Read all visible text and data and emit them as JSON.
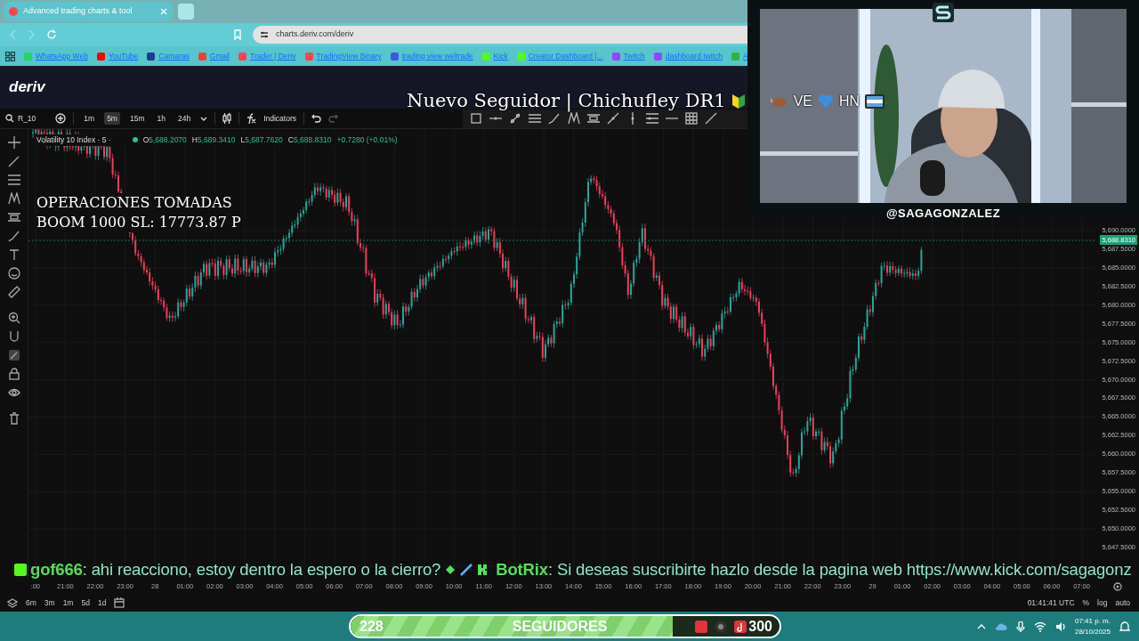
{
  "browser": {
    "tabs": [
      {
        "title": "Advanced trading charts & tool",
        "selected": true
      }
    ],
    "url": "charts.deriv.com/deriv",
    "bookmarks": [
      {
        "label": "WhatsApp Web",
        "color": "#25d366"
      },
      {
        "label": "YouTube",
        "color": "#ff0000"
      },
      {
        "label": "Camaras",
        "color": "#1d3f8a"
      },
      {
        "label": "Gmail",
        "color": "#ea4335"
      },
      {
        "label": "Trader | Deriv",
        "color": "#ff444f"
      },
      {
        "label": "TradingView Binary",
        "color": "#ff444f"
      },
      {
        "label": "trading view weltrade",
        "color": "#3b5bdb"
      },
      {
        "label": "Kick",
        "color": "#53fc18"
      },
      {
        "label": "Creator Dashboard |...",
        "color": "#53fc18"
      },
      {
        "label": "Twitch",
        "color": "#9146ff"
      },
      {
        "label": "dashboard twitch",
        "color": "#9146ff"
      },
      {
        "label": "A",
        "color": "#2fb344"
      }
    ]
  },
  "app": {
    "logo": "deriv",
    "symbol": "R_10",
    "intervals": [
      {
        "label": "1m",
        "selected": false
      },
      {
        "label": "5m",
        "selected": true
      },
      {
        "label": "15m",
        "selected": false
      },
      {
        "label": "1h",
        "selected": false
      },
      {
        "label": "24h",
        "selected": false
      }
    ],
    "indicators": "Indicators"
  },
  "legend": {
    "title": "Volatility 10 Index · 5 ·",
    "ohlc": [
      {
        "key": "O",
        "value": "5,688.2070"
      },
      {
        "key": "H",
        "value": "5,689.3410"
      },
      {
        "key": "L",
        "value": "5,687.7620"
      },
      {
        "key": "C",
        "value": "5,688.8310"
      }
    ],
    "change": "+0.7280 (+0.01%)"
  },
  "overlay_text": [
    "OPERACIONES TOMADAS",
    "BOOM 1000 SL: 17773.87 P"
  ],
  "price_axis": [
    "5,690.0000",
    "5,687.5000",
    "5,685.0000",
    "5,682.5000",
    "5,680.0000",
    "5,677.5000",
    "5,675.0000",
    "5,672.5000",
    "5,670.0000",
    "5,667.5000",
    "5,665.0000",
    "5,662.5000",
    "5,660.0000",
    "5,657.5000",
    "5,655.0000",
    "5,652.5000",
    "5,650.0000",
    "5,647.5000"
  ],
  "current_price": "5,688.8310",
  "time_axis": [
    ":00",
    "21:00",
    "22:00",
    "23:00",
    "28",
    "01:00",
    "02:00",
    "03:00",
    "04:00",
    "05:00",
    "06:00",
    "07:00",
    "08:00",
    "09:00",
    "10:00",
    "11:00",
    "12:00",
    "13:00",
    "14:00",
    "15:00",
    "16:00",
    "17:00",
    "18:00",
    "19:00",
    "20:00",
    "21:00",
    "22:00",
    "23:00",
    "29",
    "01:00",
    "02:00",
    "03:00",
    "04:00",
    "05:00",
    "06:00",
    "07:00"
  ],
  "periods": [
    "6m",
    "3m",
    "1m",
    "5d",
    "1d"
  ],
  "clock": "01:41:41 UTC",
  "scale_options": [
    "%",
    "log",
    "auto"
  ],
  "follower_alert": {
    "text": "Nuevo Seguidor | Chichufley DR1",
    "tags": [
      "VE",
      "HN"
    ]
  },
  "webcam": {
    "kind": "picture",
    "handle": "@SAGAGONZALEZ"
  },
  "chat": [
    {
      "user": "gof666",
      "message": ": ahi reacciono, estoy dentro la espero o la cierro?"
    },
    {
      "user": "BotRix",
      "message": ": Si deseas suscribirte hazlo desde la pagina web https://www.kick.com/sagagonz"
    }
  ],
  "follower_goal": {
    "current": "228",
    "label": "SEGUIDORES",
    "target": "300",
    "level": 0.75
  },
  "taskbar": {
    "time": "07:41 p. m.",
    "date": "28/10/2025"
  }
}
